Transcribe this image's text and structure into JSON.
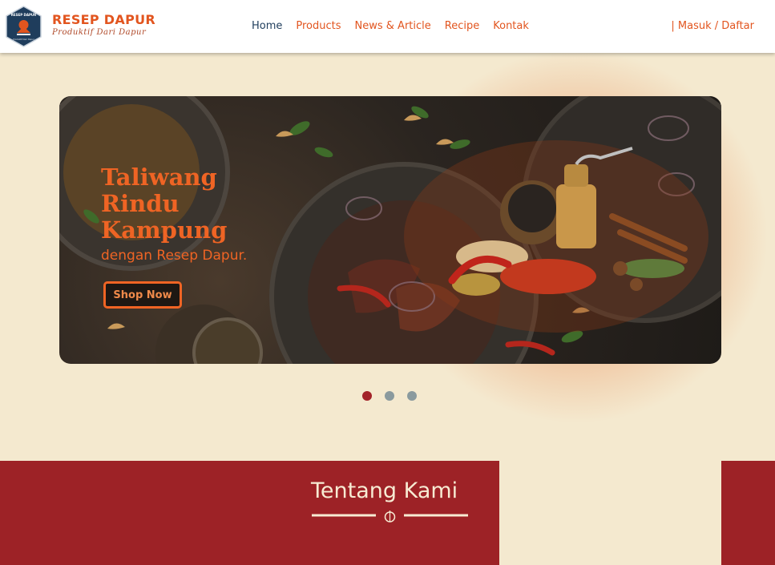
{
  "brand": {
    "name": "RESEP DAPUR",
    "tagline": "Produktif Dari Dapur"
  },
  "nav": {
    "items": [
      {
        "label": "Home",
        "active": true
      },
      {
        "label": "Products",
        "active": false
      },
      {
        "label": "News & Article",
        "active": false
      },
      {
        "label": "Recipe",
        "active": false
      },
      {
        "label": "Kontak",
        "active": false
      }
    ],
    "auth_label": "| Masuk / Daftar"
  },
  "hero": {
    "title_lines": [
      "Taliwang",
      "Rindu",
      "Kampung"
    ],
    "subtitle": "dengan Resep Dapur.",
    "button_label": "Shop Now"
  },
  "carousel": {
    "slides": 3,
    "active": 1
  },
  "about": {
    "title": "Tentang Kami"
  },
  "colors": {
    "accent": "#ef6424",
    "nav_active": "#1f3d5c",
    "maroon": "#9d2226",
    "cream": "#f4e9cf"
  }
}
